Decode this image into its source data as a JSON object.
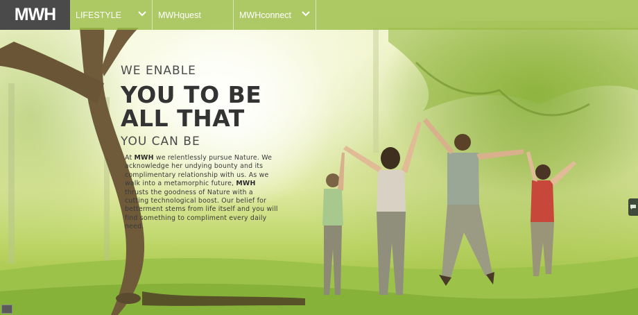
{
  "brand": {
    "logo_text": "MWH"
  },
  "nav": {
    "items": [
      {
        "label": "LIFESTYLE",
        "has_dropdown": true
      },
      {
        "label": "MWHquest",
        "has_dropdown": false
      },
      {
        "label": "MWHconnect",
        "has_dropdown": true
      }
    ],
    "chevron_icon": "chevron-down-icon"
  },
  "hero": {
    "line1": "WE ENABLE",
    "line2": "YOU TO BE",
    "line3": "ALL THAT",
    "line4": "YOU CAN BE",
    "body": {
      "p1": "At ",
      "brand1": "MWH",
      "p2": " we relentlessly pursue Nature. We acknowledge her undying bounty and its complimentary relationship with us. As we walk into a metamorphic future, ",
      "brand2": "MWH",
      "p3": " thrusts the goodness of Nature with a cutting technological boost. Our belief for betterment stems from life itself and you will find something to compliment every daily need."
    }
  },
  "widgets": {
    "feedback_icon": "chat-icon",
    "corner_icon": "menu-icon"
  },
  "colors": {
    "nav_bg": "#9cbe4a",
    "logo_bg": "#4a4a4a",
    "text_dark": "#333333"
  }
}
